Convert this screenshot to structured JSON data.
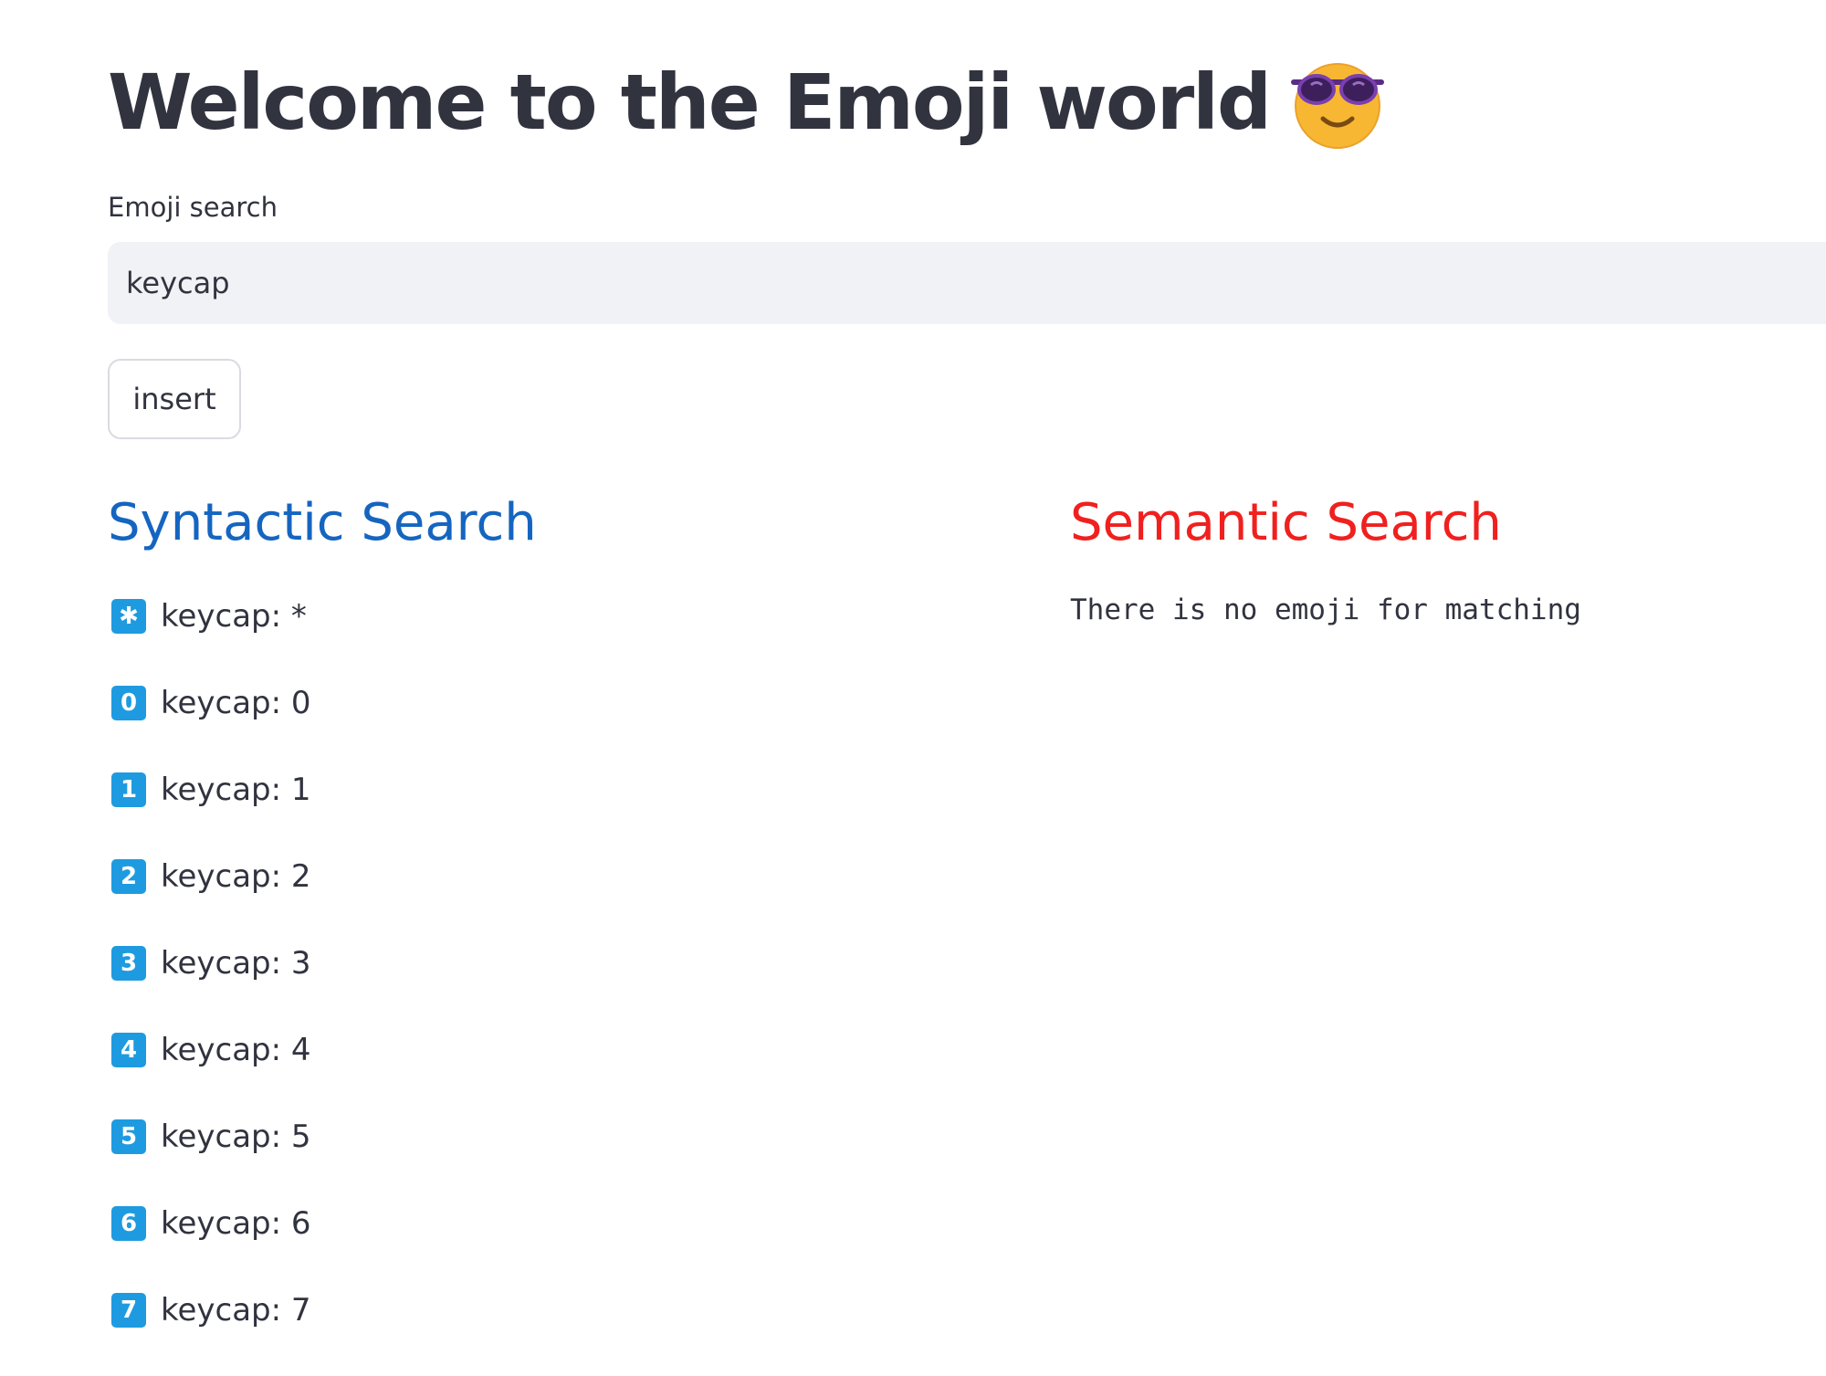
{
  "header": {
    "title": "Welcome to the Emoji world",
    "title_emoji": "smiling-face-with-sunglasses-icon"
  },
  "search": {
    "label": "Emoji search",
    "value": "keycap"
  },
  "insert_button": {
    "label": "insert"
  },
  "syntactic": {
    "heading": "Syntactic Search",
    "heading_color": "#1565c0",
    "results": [
      {
        "symbol": "✱",
        "label": "keycap: *"
      },
      {
        "symbol": "0",
        "label": "keycap: 0"
      },
      {
        "symbol": "1",
        "label": "keycap: 1"
      },
      {
        "symbol": "2",
        "label": "keycap: 2"
      },
      {
        "symbol": "3",
        "label": "keycap: 3"
      },
      {
        "symbol": "4",
        "label": "keycap: 4"
      },
      {
        "symbol": "5",
        "label": "keycap: 5"
      },
      {
        "symbol": "6",
        "label": "keycap: 6"
      },
      {
        "symbol": "7",
        "label": "keycap: 7"
      }
    ]
  },
  "semantic": {
    "heading": "Semantic Search",
    "heading_color": "#f0201f",
    "message": "There is no emoji for matching"
  },
  "colors": {
    "keycap_blue": "#1e9be0",
    "text": "#31333f",
    "input_background": "#f0f2f6"
  }
}
